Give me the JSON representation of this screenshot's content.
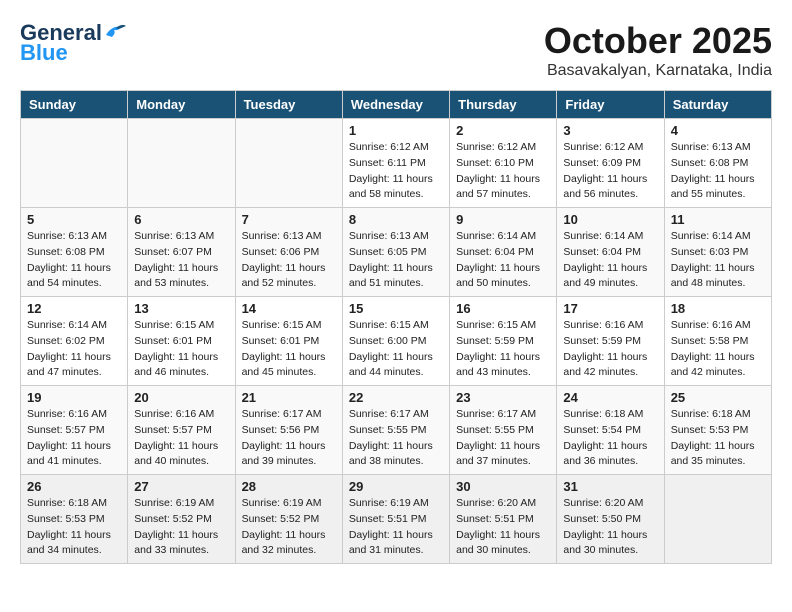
{
  "header": {
    "logo_general": "General",
    "logo_blue": "Blue",
    "month_title": "October 2025",
    "location": "Basavakalyan, Karnataka, India"
  },
  "days_of_week": [
    "Sunday",
    "Monday",
    "Tuesday",
    "Wednesday",
    "Thursday",
    "Friday",
    "Saturday"
  ],
  "weeks": [
    [
      {
        "day": "",
        "info": ""
      },
      {
        "day": "",
        "info": ""
      },
      {
        "day": "",
        "info": ""
      },
      {
        "day": "1",
        "info": "Sunrise: 6:12 AM\nSunset: 6:11 PM\nDaylight: 11 hours\nand 58 minutes."
      },
      {
        "day": "2",
        "info": "Sunrise: 6:12 AM\nSunset: 6:10 PM\nDaylight: 11 hours\nand 57 minutes."
      },
      {
        "day": "3",
        "info": "Sunrise: 6:12 AM\nSunset: 6:09 PM\nDaylight: 11 hours\nand 56 minutes."
      },
      {
        "day": "4",
        "info": "Sunrise: 6:13 AM\nSunset: 6:08 PM\nDaylight: 11 hours\nand 55 minutes."
      }
    ],
    [
      {
        "day": "5",
        "info": "Sunrise: 6:13 AM\nSunset: 6:08 PM\nDaylight: 11 hours\nand 54 minutes."
      },
      {
        "day": "6",
        "info": "Sunrise: 6:13 AM\nSunset: 6:07 PM\nDaylight: 11 hours\nand 53 minutes."
      },
      {
        "day": "7",
        "info": "Sunrise: 6:13 AM\nSunset: 6:06 PM\nDaylight: 11 hours\nand 52 minutes."
      },
      {
        "day": "8",
        "info": "Sunrise: 6:13 AM\nSunset: 6:05 PM\nDaylight: 11 hours\nand 51 minutes."
      },
      {
        "day": "9",
        "info": "Sunrise: 6:14 AM\nSunset: 6:04 PM\nDaylight: 11 hours\nand 50 minutes."
      },
      {
        "day": "10",
        "info": "Sunrise: 6:14 AM\nSunset: 6:04 PM\nDaylight: 11 hours\nand 49 minutes."
      },
      {
        "day": "11",
        "info": "Sunrise: 6:14 AM\nSunset: 6:03 PM\nDaylight: 11 hours\nand 48 minutes."
      }
    ],
    [
      {
        "day": "12",
        "info": "Sunrise: 6:14 AM\nSunset: 6:02 PM\nDaylight: 11 hours\nand 47 minutes."
      },
      {
        "day": "13",
        "info": "Sunrise: 6:15 AM\nSunset: 6:01 PM\nDaylight: 11 hours\nand 46 minutes."
      },
      {
        "day": "14",
        "info": "Sunrise: 6:15 AM\nSunset: 6:01 PM\nDaylight: 11 hours\nand 45 minutes."
      },
      {
        "day": "15",
        "info": "Sunrise: 6:15 AM\nSunset: 6:00 PM\nDaylight: 11 hours\nand 44 minutes."
      },
      {
        "day": "16",
        "info": "Sunrise: 6:15 AM\nSunset: 5:59 PM\nDaylight: 11 hours\nand 43 minutes."
      },
      {
        "day": "17",
        "info": "Sunrise: 6:16 AM\nSunset: 5:59 PM\nDaylight: 11 hours\nand 42 minutes."
      },
      {
        "day": "18",
        "info": "Sunrise: 6:16 AM\nSunset: 5:58 PM\nDaylight: 11 hours\nand 42 minutes."
      }
    ],
    [
      {
        "day": "19",
        "info": "Sunrise: 6:16 AM\nSunset: 5:57 PM\nDaylight: 11 hours\nand 41 minutes."
      },
      {
        "day": "20",
        "info": "Sunrise: 6:16 AM\nSunset: 5:57 PM\nDaylight: 11 hours\nand 40 minutes."
      },
      {
        "day": "21",
        "info": "Sunrise: 6:17 AM\nSunset: 5:56 PM\nDaylight: 11 hours\nand 39 minutes."
      },
      {
        "day": "22",
        "info": "Sunrise: 6:17 AM\nSunset: 5:55 PM\nDaylight: 11 hours\nand 38 minutes."
      },
      {
        "day": "23",
        "info": "Sunrise: 6:17 AM\nSunset: 5:55 PM\nDaylight: 11 hours\nand 37 minutes."
      },
      {
        "day": "24",
        "info": "Sunrise: 6:18 AM\nSunset: 5:54 PM\nDaylight: 11 hours\nand 36 minutes."
      },
      {
        "day": "25",
        "info": "Sunrise: 6:18 AM\nSunset: 5:53 PM\nDaylight: 11 hours\nand 35 minutes."
      }
    ],
    [
      {
        "day": "26",
        "info": "Sunrise: 6:18 AM\nSunset: 5:53 PM\nDaylight: 11 hours\nand 34 minutes."
      },
      {
        "day": "27",
        "info": "Sunrise: 6:19 AM\nSunset: 5:52 PM\nDaylight: 11 hours\nand 33 minutes."
      },
      {
        "day": "28",
        "info": "Sunrise: 6:19 AM\nSunset: 5:52 PM\nDaylight: 11 hours\nand 32 minutes."
      },
      {
        "day": "29",
        "info": "Sunrise: 6:19 AM\nSunset: 5:51 PM\nDaylight: 11 hours\nand 31 minutes."
      },
      {
        "day": "30",
        "info": "Sunrise: 6:20 AM\nSunset: 5:51 PM\nDaylight: 11 hours\nand 30 minutes."
      },
      {
        "day": "31",
        "info": "Sunrise: 6:20 AM\nSunset: 5:50 PM\nDaylight: 11 hours\nand 30 minutes."
      },
      {
        "day": "",
        "info": ""
      }
    ]
  ]
}
